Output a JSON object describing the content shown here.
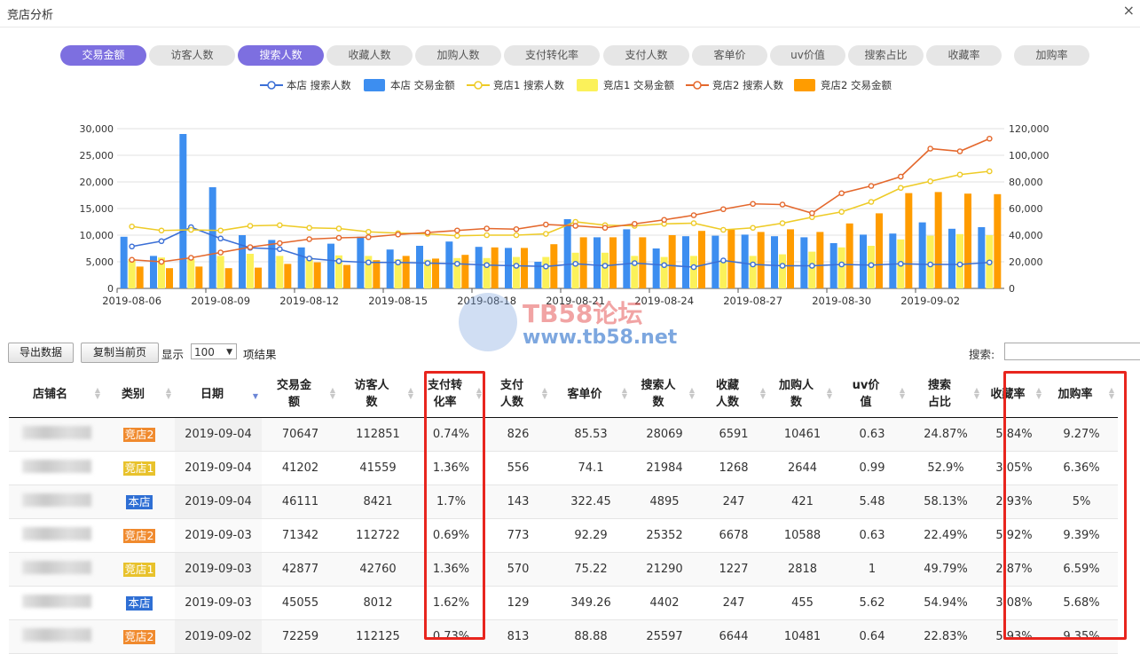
{
  "window": {
    "title": "竞店分析",
    "close_label": "×"
  },
  "tabs": [
    {
      "label": "交易金额",
      "active": true
    },
    {
      "label": "访客人数",
      "active": false
    },
    {
      "label": "搜索人数",
      "active": true
    },
    {
      "label": "收藏人数",
      "active": false
    },
    {
      "label": "加购人数",
      "active": false
    },
    {
      "label": "支付转化率",
      "active": false
    },
    {
      "label": "支付人数",
      "active": false
    },
    {
      "label": "客单价",
      "active": false
    },
    {
      "label": "uv价值",
      "active": false
    },
    {
      "label": "搜索占比",
      "active": false
    },
    {
      "label": "收藏率",
      "active": false
    },
    {
      "label": "加购率",
      "active": false
    }
  ],
  "chart_data": {
    "type": "bar",
    "title": "",
    "x": [
      "2019-08-06",
      "2019-08-07",
      "2019-08-08",
      "2019-08-09",
      "2019-08-10",
      "2019-08-11",
      "2019-08-12",
      "2019-08-13",
      "2019-08-14",
      "2019-08-15",
      "2019-08-16",
      "2019-08-17",
      "2019-08-18",
      "2019-08-19",
      "2019-08-20",
      "2019-08-21",
      "2019-08-22",
      "2019-08-23",
      "2019-08-24",
      "2019-08-25",
      "2019-08-26",
      "2019-08-27",
      "2019-08-28",
      "2019-08-29",
      "2019-08-30",
      "2019-08-31",
      "2019-09-01",
      "2019-09-02",
      "2019-09-03",
      "2019-09-04"
    ],
    "x_tick_labels": [
      "2019-08-06",
      "2019-08-09",
      "2019-08-12",
      "2019-08-15",
      "2019-08-18",
      "2019-08-21",
      "2019-08-24",
      "2019-08-27",
      "2019-08-30",
      "2019-09-02"
    ],
    "y_left": {
      "min": 0,
      "max": 30000,
      "ticks": [
        "0",
        "5,000",
        "10,000",
        "15,000",
        "20,000",
        "25,000",
        "30,000"
      ]
    },
    "y_right": {
      "min": 0,
      "max": 120000,
      "ticks": [
        "0",
        "20,000",
        "40,000",
        "60,000",
        "80,000",
        "100,000",
        "120,000"
      ]
    },
    "grid": true,
    "legend_position": "top",
    "series": [
      {
        "name": "本店 搜索人数",
        "kind": "line",
        "axis": "right",
        "color": "#3b6fd6",
        "values": [
          31500,
          35500,
          46000,
          37500,
          30500,
          29500,
          22500,
          20500,
          19500,
          19500,
          19000,
          18500,
          17500,
          17000,
          16500,
          18500,
          17000,
          19000,
          17500,
          16000,
          21000,
          18000,
          17000,
          17000,
          18000,
          17500,
          18500,
          18000,
          18000,
          19500
        ]
      },
      {
        "name": "本店 交易金额",
        "kind": "bar",
        "axis": "left",
        "color": "#3d8ef0",
        "values": [
          9700,
          6100,
          29000,
          19000,
          10000,
          9100,
          7700,
          8400,
          9700,
          7300,
          8000,
          8800,
          7800,
          7600,
          5000,
          13000,
          9600,
          11100,
          7500,
          9800,
          9900,
          10100,
          9800,
          9600,
          8500,
          10100,
          10300,
          12400,
          11200,
          11500
        ]
      },
      {
        "name": "竞店1 搜索人数",
        "kind": "line",
        "axis": "right",
        "color": "#eecb27",
        "values": [
          46500,
          43500,
          44000,
          43500,
          47000,
          47500,
          45500,
          45000,
          42500,
          41500,
          41000,
          39500,
          40000,
          40000,
          41000,
          50000,
          47500,
          47000,
          48500,
          49000,
          44000,
          45500,
          49000,
          53500,
          57500,
          65000,
          75500,
          80500,
          85500,
          88000
        ]
      },
      {
        "name": "竞店1 交易金额",
        "kind": "bar",
        "axis": "left",
        "color": "#fbf15a",
        "values": [
          5500,
          5800,
          5500,
          6100,
          6500,
          6100,
          5800,
          6200,
          6100,
          5500,
          5400,
          5700,
          5700,
          5900,
          5900,
          6700,
          6700,
          6100,
          5900,
          6100,
          5100,
          6100,
          6400,
          6900,
          7700,
          8000,
          9200,
          9900,
          10200,
          10000
        ]
      },
      {
        "name": "竞店2 搜索人数",
        "kind": "line",
        "axis": "right",
        "color": "#e4682d",
        "values": [
          21500,
          20000,
          23000,
          27000,
          31000,
          34000,
          37000,
          38000,
          38500,
          40500,
          42000,
          43500,
          45000,
          44500,
          48000,
          47000,
          45500,
          48500,
          51500,
          55000,
          59500,
          63500,
          63000,
          56500,
          71500,
          77000,
          84000,
          105000,
          103000,
          112500
        ]
      },
      {
        "name": "竞店2 交易金额",
        "kind": "bar",
        "axis": "left",
        "color": "#ff9c00",
        "values": [
          4100,
          3800,
          4100,
          3800,
          3900,
          4600,
          4900,
          4400,
          5300,
          6100,
          5600,
          6300,
          7700,
          7600,
          8300,
          9600,
          9600,
          9600,
          10000,
          10800,
          11000,
          10600,
          11100,
          10600,
          12200,
          14100,
          17900,
          18100,
          17800,
          17700
        ]
      }
    ]
  },
  "controls": {
    "export_label": "导出数据",
    "copy_label": "复制当前页",
    "show_label": "显示",
    "page_size": "100",
    "results_label": "项结果",
    "search_label": "搜索:"
  },
  "watermark": {
    "title": "TB58论坛",
    "url": "www.tb58.net"
  },
  "table": {
    "columns": [
      "店铺名",
      "类别",
      "日期",
      "交易金额",
      "访客人数",
      "支付转化率",
      "支付人数",
      "客单价",
      "搜索人数",
      "收藏人数",
      "加购人数",
      "uv价值",
      "搜索占比",
      "收藏率",
      "加购率"
    ],
    "rows": [
      {
        "category": "竞店2",
        "category_color": "#f08a2e",
        "date": "2019-09-04",
        "amount": "70647",
        "visitors": "112851",
        "conv": "0.74%",
        "payers": "826",
        "aov": "85.53",
        "search": "28069",
        "fav": "6591",
        "cart": "10461",
        "uv": "0.63",
        "search_share": "24.87%",
        "fav_rate": "5.84%",
        "cart_rate": "9.27%"
      },
      {
        "category": "竞店1",
        "category_color": "#e8c22c",
        "date": "2019-09-04",
        "amount": "41202",
        "visitors": "41559",
        "conv": "1.36%",
        "payers": "556",
        "aov": "74.1",
        "search": "21984",
        "fav": "1268",
        "cart": "2644",
        "uv": "0.99",
        "search_share": "52.9%",
        "fav_rate": "3.05%",
        "cart_rate": "6.36%"
      },
      {
        "category": "本店",
        "category_color": "#2f6fd4",
        "date": "2019-09-04",
        "amount": "46111",
        "visitors": "8421",
        "conv": "1.7%",
        "payers": "143",
        "aov": "322.45",
        "search": "4895",
        "fav": "247",
        "cart": "421",
        "uv": "5.48",
        "search_share": "58.13%",
        "fav_rate": "2.93%",
        "cart_rate": "5%"
      },
      {
        "category": "竞店2",
        "category_color": "#f08a2e",
        "date": "2019-09-03",
        "amount": "71342",
        "visitors": "112722",
        "conv": "0.69%",
        "payers": "773",
        "aov": "92.29",
        "search": "25352",
        "fav": "6678",
        "cart": "10588",
        "uv": "0.63",
        "search_share": "22.49%",
        "fav_rate": "5.92%",
        "cart_rate": "9.39%"
      },
      {
        "category": "竞店1",
        "category_color": "#e8c22c",
        "date": "2019-09-03",
        "amount": "42877",
        "visitors": "42760",
        "conv": "1.36%",
        "payers": "570",
        "aov": "75.22",
        "search": "21290",
        "fav": "1227",
        "cart": "2818",
        "uv": "1",
        "search_share": "49.79%",
        "fav_rate": "2.87%",
        "cart_rate": "6.59%"
      },
      {
        "category": "本店",
        "category_color": "#2f6fd4",
        "date": "2019-09-03",
        "amount": "45055",
        "visitors": "8012",
        "conv": "1.62%",
        "payers": "129",
        "aov": "349.26",
        "search": "4402",
        "fav": "247",
        "cart": "455",
        "uv": "5.62",
        "search_share": "54.94%",
        "fav_rate": "3.08%",
        "cart_rate": "5.68%"
      },
      {
        "category": "竞店2",
        "category_color": "#f08a2e",
        "date": "2019-09-02",
        "amount": "72259",
        "visitors": "112125",
        "conv": "0.73%",
        "payers": "813",
        "aov": "88.88",
        "search": "25597",
        "fav": "6644",
        "cart": "10481",
        "uv": "0.64",
        "search_share": "22.83%",
        "fav_rate": "5.93%",
        "cart_rate": "9.35%"
      }
    ]
  }
}
